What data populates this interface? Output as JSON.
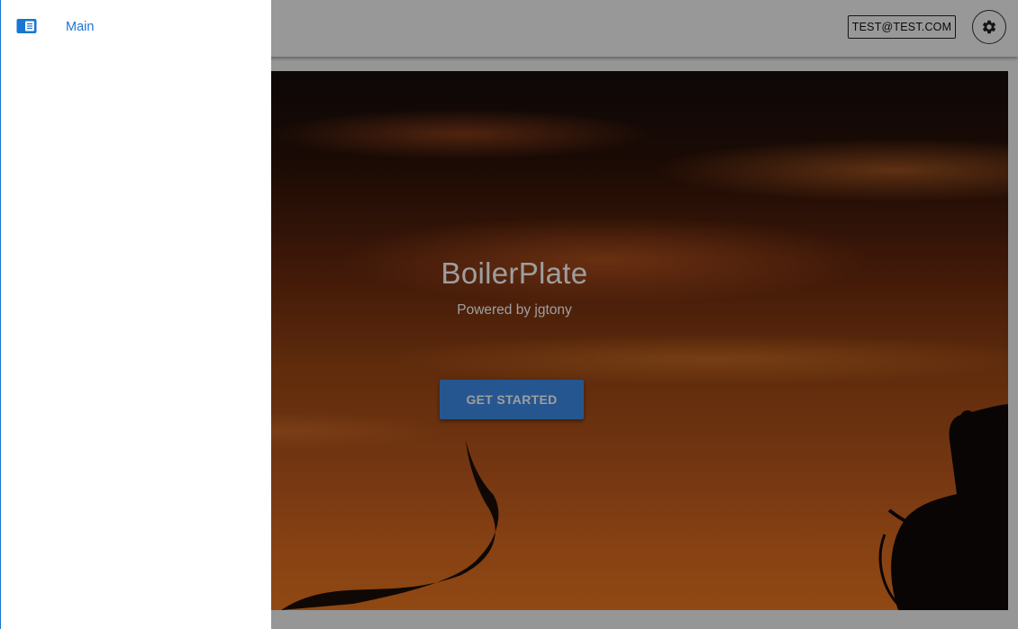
{
  "drawer": {
    "items": [
      {
        "label": "Main",
        "icon": "view-module-icon",
        "active": true
      }
    ],
    "accent_color": "#1976d2"
  },
  "app_bar": {
    "user_label": "TEST@TEST.COM",
    "settings_icon": "gear-icon"
  },
  "hero": {
    "title": "BoilerPlate",
    "subtitle": "Powered by jgtony",
    "cta_label": "GET STARTED",
    "cta_color": "#3d8be8"
  }
}
